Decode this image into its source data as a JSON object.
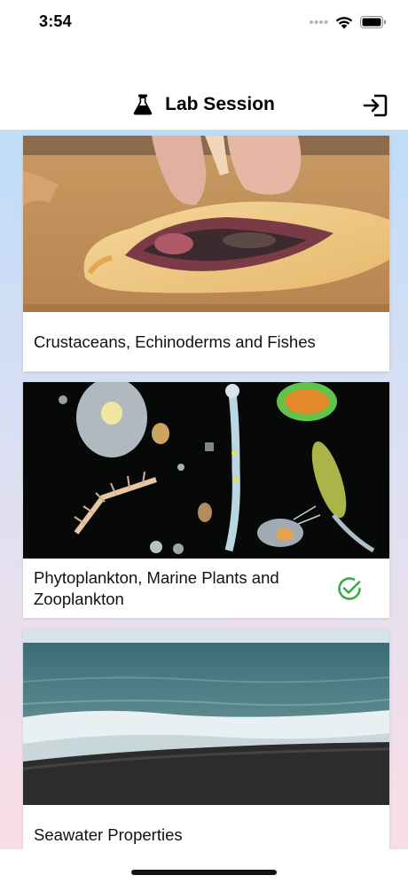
{
  "status_bar": {
    "time": "3:54",
    "icons": [
      "cellular-signal-icon",
      "wifi-icon",
      "battery-icon"
    ]
  },
  "nav": {
    "title": "Lab Session",
    "title_icon": "flask-icon",
    "right_icon": "logout-icon"
  },
  "cards": [
    {
      "title": "Crustaceans, Echinoderms and Fishes",
      "image": "fish-dissection-photo",
      "completed": false
    },
    {
      "title": "Phytoplankton, Marine Plants and Zooplankton",
      "image": "plankton-photo",
      "completed": true
    },
    {
      "title": "Seawater Properties",
      "image": "ocean-waves-photo",
      "completed": false
    }
  ],
  "colors": {
    "check_green": "#3aab47",
    "background_top": "#bfdcf8",
    "background_bottom": "#f9dde4"
  }
}
